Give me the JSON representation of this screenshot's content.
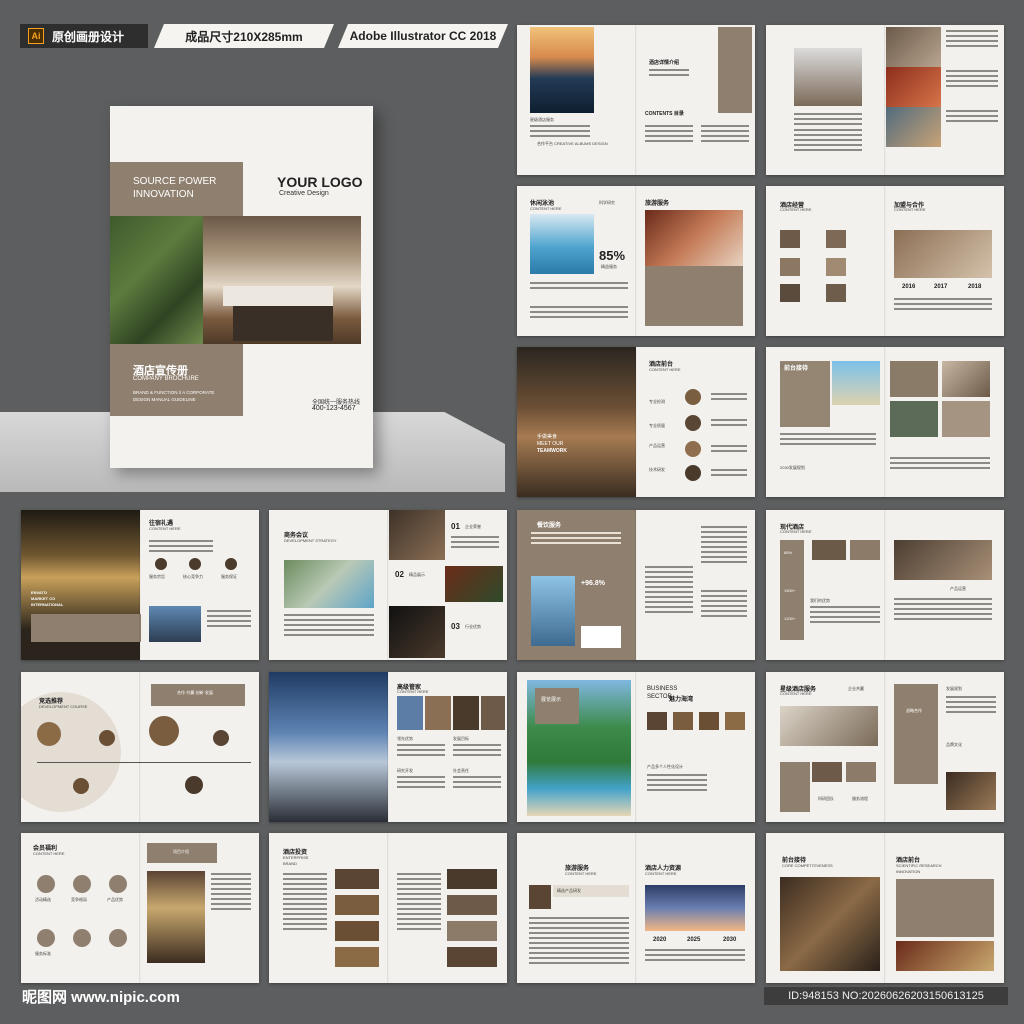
{
  "header": {
    "ai_badge": "Ai",
    "design_tag": "原创画册设计",
    "size_tag": "成品尺寸210X285mm",
    "software_tag": "Adobe Illustrator CC 2018"
  },
  "cover": {
    "tagline_1": "SOURCE POWER",
    "tagline_2": "INNOVATION",
    "logo": "YOUR LOGO",
    "logo_sub": "Creative Design",
    "title_cn": "酒店宣传册",
    "title_en": "COMPANY BROCHURE",
    "desc_1": "BRAND & FUNCTION // A CORPORATE",
    "desc_2": "DESIGN MANUAL GUIDELINE",
    "hotline_label": "全国统一服务热线",
    "hotline": "400-123-4567"
  },
  "spreads": {
    "s1": {
      "brand": "星级酒店服务",
      "title": "酒店详情介绍",
      "contents": "CONTENTS 目录",
      "footer": "合作平台 CREATIVE ALBUMS DESIGN"
    },
    "s3": {
      "title": "休闲泳池",
      "sub": "CONTENT HERE",
      "tag": "科学研究",
      "percent": "85%",
      "caption": "精益服务",
      "title2": "旅游服务"
    },
    "s4": {
      "title": "酒店经营",
      "sub": "CONTENT HERE",
      "title2": "加盟与合作",
      "y1": "2016",
      "y2": "2017",
      "y3": "2018"
    },
    "s5": {
      "overlay_1": "手做美食",
      "overlay_2": "MEET OUR",
      "overlay_3": "TEAMWORK",
      "title": "酒店前台",
      "sub": "CONTENT HERE",
      "label_a": "专业检测",
      "label_b": "专业质量",
      "label_c": "产品运营",
      "label_d": "技术研发"
    },
    "s6": {
      "title": "前台接待",
      "sub": "CONTENT HERE",
      "year": "2030发展规划"
    },
    "s7": {
      "title": "往宿礼遇",
      "sub": "CONTENT HERE",
      "ov_1": "ENVATO",
      "ov_2": "MARKET CO",
      "ov_3": "INTERNATIONAL",
      "b1": "服务宗旨",
      "b2": "核心竞争力",
      "b3": "服务保证"
    },
    "s8": {
      "title": "商务会议",
      "sub": "DEVELOPMENT STRATEGY",
      "n1": "01",
      "n1_label": "企业荣誉",
      "n2": "02",
      "n2_label": "精品展示",
      "n3": "03",
      "n3_label": "行业优势"
    },
    "s9": {
      "title": "餐饮服务",
      "percent": "+96.8%"
    },
    "s10": {
      "title": "现代酒店",
      "sub": "CONTENT HERE",
      "stat1": "85%",
      "stat2": "1500+",
      "stat3": "1200+",
      "c1": "我们的优势",
      "c2": "产品运营"
    },
    "s11": {
      "title": "竞选推荐",
      "sub": "DEVELOPMENT COURSE",
      "band": "合作·共赢·创新·发展"
    },
    "s12": {
      "title": "高级管家",
      "sub": "CONTENT HERE",
      "l1": "领先优势",
      "l2": "发展目标",
      "l3": "研究开发",
      "l4": "社会责任"
    },
    "s13": {
      "overlay": "展览展示",
      "title_1": "BUSINESS",
      "title_2": "SECTOR",
      "title_cn": "魅力海湾",
      "sub": "产品多个人性化设计"
    },
    "s14": {
      "title": "星级酒店服务",
      "sub": "CONTENT HERE",
      "t2": "企业共赢",
      "t3": "战略合作",
      "t4": "发展规划",
      "t5": "品牌文化",
      "l1": "科研团队",
      "l2": "服务流程"
    },
    "s15": {
      "title": "会员福利",
      "sub": "CONTENT HERE",
      "band": "项目介绍",
      "i1": "活动精选",
      "i2": "竞争格局",
      "i3": "产品优势",
      "i4": "服务标准"
    },
    "s16": {
      "title": "酒店投资",
      "sub_1": "ENTERPRISE",
      "sub_2": "BRAND"
    },
    "s17": {
      "title": "旅游服务",
      "sub": "CONTENT HERE",
      "band": "精选产品研发",
      "title2": "酒店人力资源",
      "y1": "2020",
      "y2": "2025",
      "y3": "2030"
    },
    "s18": {
      "title": "前台接待",
      "sub": "CORE COMPETITIVENESS",
      "title2": "酒店前台",
      "sub2_1": "SCIENTIFIC RESEARCH",
      "sub2_2": "INNOVATION"
    }
  },
  "footer": {
    "watermark": "昵图网 www.nipic.com",
    "id": "ID:948153 NO:20260626203150613125"
  }
}
